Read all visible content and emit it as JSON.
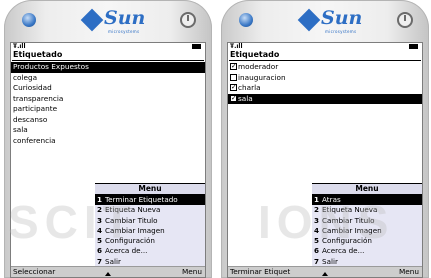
{
  "left_phone": {
    "brand": {
      "logo_text": "Sun",
      "sub_text": "microsystems"
    },
    "status": {
      "signal": "Ŧ.ıll"
    },
    "title": "Etiquetado",
    "items": [
      {
        "label": "Productos Expuestos",
        "selected": true
      },
      {
        "label": "colega",
        "selected": false
      },
      {
        "label": "Curiosidad",
        "selected": false
      },
      {
        "label": "transparencia",
        "selected": false
      },
      {
        "label": "participante",
        "selected": false
      },
      {
        "label": "descanso",
        "selected": false
      },
      {
        "label": "sala",
        "selected": false
      },
      {
        "label": "conferencia",
        "selected": false
      }
    ],
    "menu": {
      "title": "Menu",
      "items": [
        {
          "num": "1",
          "label": "Terminar Etiquetado",
          "selected": true
        },
        {
          "num": "2",
          "label": "Etiqueta Nueva",
          "selected": false
        },
        {
          "num": "3",
          "label": "Cambiar Titulo",
          "selected": false
        },
        {
          "num": "4",
          "label": "Cambiar Imagen",
          "selected": false
        },
        {
          "num": "5",
          "label": "Configuración",
          "selected": false
        },
        {
          "num": "6",
          "label": "Acerca de...",
          "selected": false
        },
        {
          "num": "7",
          "label": "Salir",
          "selected": false
        }
      ]
    },
    "softkeys": {
      "left": "Seleccionar",
      "right": "Menu"
    }
  },
  "right_phone": {
    "brand": {
      "logo_text": "Sun",
      "sub_text": "microsystems"
    },
    "status": {
      "signal": "Ŧ.ıll"
    },
    "title": "Etiquetado",
    "items": [
      {
        "label": "moderador",
        "checked": true,
        "selected": false
      },
      {
        "label": "inauguracion",
        "checked": false,
        "selected": false
      },
      {
        "label": "charla",
        "checked": true,
        "selected": false
      },
      {
        "label": "sala",
        "checked": true,
        "selected": true
      }
    ],
    "menu": {
      "title": "Menu",
      "items": [
        {
          "num": "1",
          "label": "Atras",
          "selected": true
        },
        {
          "num": "2",
          "label": "Etiqueta Nueva",
          "selected": false
        },
        {
          "num": "3",
          "label": "Cambiar Titulo",
          "selected": false
        },
        {
          "num": "4",
          "label": "Cambiar Imagen",
          "selected": false
        },
        {
          "num": "5",
          "label": "Configuración",
          "selected": false
        },
        {
          "num": "6",
          "label": "Acerca de...",
          "selected": false
        },
        {
          "num": "7",
          "label": "Salir",
          "selected": false
        }
      ]
    },
    "softkeys": {
      "left": "Terminar Etiquet",
      "right": "Menu"
    }
  },
  "watermark": {
    "left_text": "SCIT",
    "right_text": "IONS"
  },
  "colors": {
    "logo_blue": "#2d6ec4",
    "selection": "#000000",
    "menu_bg": "#e6e6f4",
    "softkey_bg": "#cdcdcd"
  }
}
